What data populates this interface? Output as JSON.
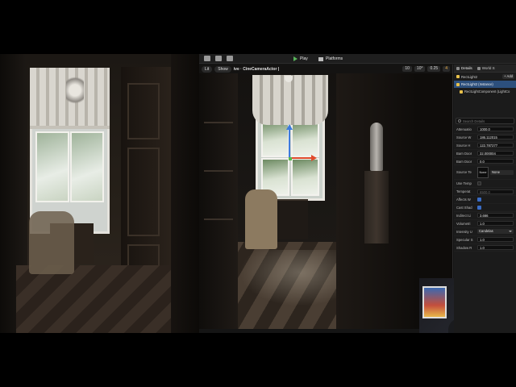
{
  "toolbar": {
    "play_label": "Play",
    "platforms_label": "Platforms"
  },
  "viewport": {
    "perspective_label": "Lit",
    "show_label": "Show",
    "camera_label": "ive · CineCameraActor |",
    "grid_value": "10",
    "rotation_value": "10°",
    "scale_value": "0.25",
    "camera_speed": "4"
  },
  "details": {
    "tab_details": "Details",
    "tab_world": "World S",
    "actor_name": "RectLight2",
    "add_label": "+ Add",
    "tree": [
      {
        "label": "RectLight2 (Instance)",
        "selected": true
      },
      {
        "label": "RectLightComponent (LightCo",
        "selected": false
      }
    ],
    "search_placeholder": "Search Details",
    "properties": [
      {
        "label": "Attenuatio",
        "value": "1000.0",
        "kind": "value"
      },
      {
        "label": "Source W",
        "value": "186.112015",
        "kind": "value"
      },
      {
        "label": "Source H",
        "value": "122.787277",
        "kind": "value"
      },
      {
        "label": "Barn Door",
        "value": "32.000004",
        "kind": "value"
      },
      {
        "label": "Barn Door",
        "value": "0.0",
        "kind": "value"
      },
      {
        "label": "Source Te",
        "thumb": "None",
        "value": "None",
        "kind": "source"
      },
      {
        "label": "Use Temp",
        "checked": false,
        "kind": "check"
      },
      {
        "label": "Temperat",
        "value": "6500.0",
        "kind": "dimvalue"
      },
      {
        "label": "Affects W",
        "checked": true,
        "kind": "check"
      },
      {
        "label": "Cast Shad",
        "checked": true,
        "kind": "check"
      },
      {
        "label": "Indirect Li",
        "value": "3.666",
        "kind": "value"
      },
      {
        "label": "Volumetri",
        "value": "1.0",
        "kind": "value"
      },
      {
        "label": "Intensity U",
        "value": "Candelas",
        "kind": "dropdown"
      },
      {
        "label": "Specular S",
        "value": "1.0",
        "kind": "value"
      },
      {
        "label": "Shadow R",
        "value": "1.0",
        "kind": "value"
      }
    ]
  }
}
